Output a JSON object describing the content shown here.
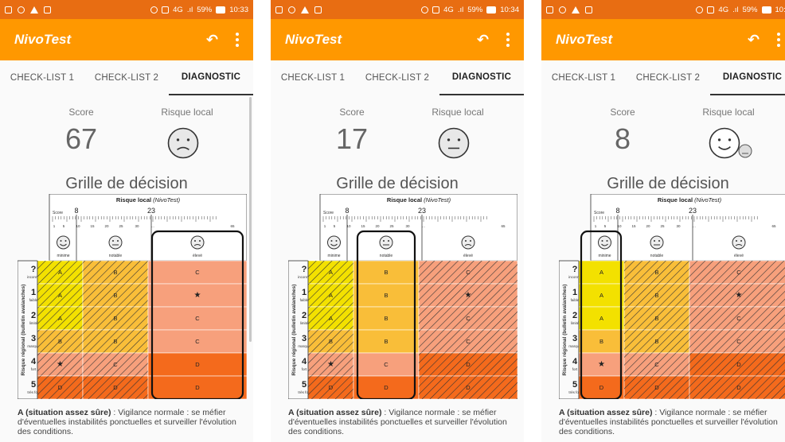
{
  "status_bar": {
    "network": "4G",
    "battery": "59%",
    "times": [
      "10:33",
      "10:34",
      "10:3"
    ]
  },
  "app": {
    "title": "NivoTest"
  },
  "tabs": [
    "CHECK-LIST 1",
    "CHECK-LIST 2",
    "DIAGNOSTIC"
  ],
  "labels": {
    "score": "Score",
    "risk_local": "Risque local",
    "grid_title": "Grille de décision"
  },
  "grid": {
    "header_title": "Risque local",
    "header_title_suffix": "(NivoTest)",
    "score_label": "Score",
    "marker_8": "8",
    "marker_23": "23",
    "ticks": [
      "1",
      "5",
      "10",
      "15",
      "20",
      "25",
      "30",
      "...",
      "65"
    ],
    "columns": [
      "minime",
      "notable",
      "élevé"
    ],
    "row_axis_label": "Risque régional (bulletin avalanches)",
    "rows": [
      {
        "num": "?",
        "label": "inconnu"
      },
      {
        "num": "1",
        "label": "faible"
      },
      {
        "num": "2",
        "label": "limité"
      },
      {
        "num": "3",
        "label": "marqué"
      },
      {
        "num": "4",
        "label": "fort"
      },
      {
        "num": "5",
        "label": "très fort"
      }
    ],
    "cells": [
      [
        "A",
        "B",
        "C"
      ],
      [
        "A",
        "B",
        "★"
      ],
      [
        "A",
        "B",
        "C"
      ],
      [
        "B",
        "B",
        "C"
      ],
      [
        "★",
        "C",
        "D"
      ],
      [
        "D",
        "D",
        "D"
      ]
    ],
    "colors": {
      "A": "#f3e100",
      "B": "#f9be39",
      "C": "#f7a07c",
      "star": "#f7a07c",
      "D": "#f46a1c"
    }
  },
  "screens": [
    {
      "score": "67",
      "risk_face": "sad",
      "highlight_column": 2
    },
    {
      "score": "17",
      "risk_face": "neutral",
      "highlight_column": 1
    },
    {
      "score": "8",
      "risk_face": "happy",
      "highlight_column": 0
    }
  ],
  "caption": {
    "bold": "A (situation assez sûre)",
    "text": " : Vigilance normale : se méfier d'éventuelles instabilités ponctuelles et surveiller l'évolution des conditions."
  }
}
